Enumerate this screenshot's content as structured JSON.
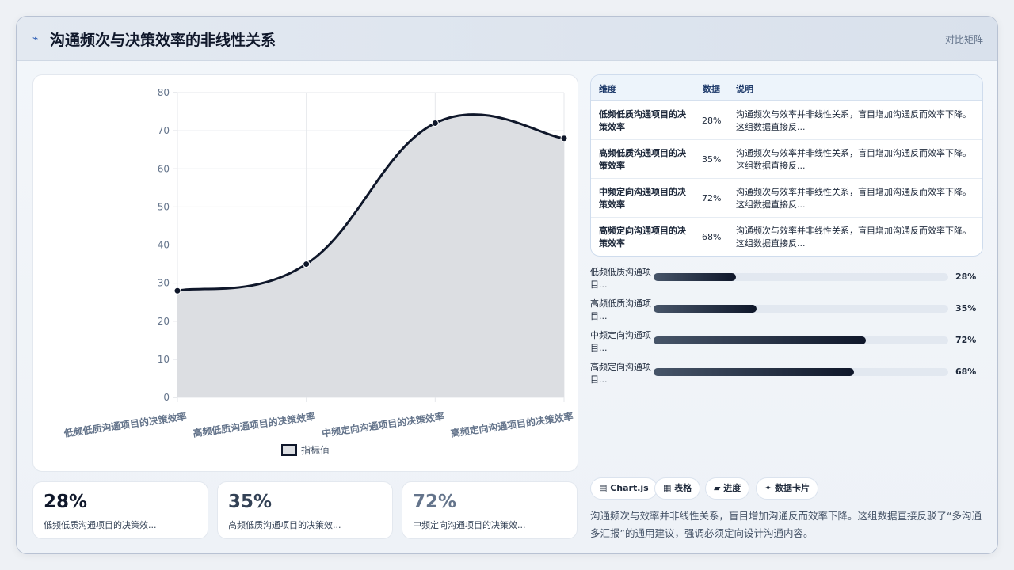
{
  "header": {
    "icon": "flash-icon",
    "title": "沟通频次与决策效率的非线性关系",
    "right_label": "对比矩阵"
  },
  "chart_data": {
    "type": "line",
    "categories": [
      "低频低质沟通项目的决策效率",
      "高频低质沟通项目的决策效率",
      "中频定向沟通项目的决策效率",
      "高频定向沟通项目的决策效率"
    ],
    "series": [
      {
        "name": "指标值",
        "values": [
          28,
          35,
          72,
          68
        ]
      }
    ],
    "ylim": [
      0,
      80
    ],
    "yticks": [
      0,
      10,
      20,
      30,
      40,
      50,
      60,
      70,
      80
    ],
    "legend": "bottom",
    "grid": true,
    "fill": true,
    "colors": {
      "line": "#0f172a",
      "fill": "#dcdee2"
    }
  },
  "stats": [
    {
      "value": "28%",
      "label": "低频低质沟通项目的决策效...",
      "color": "#0f172a"
    },
    {
      "value": "35%",
      "label": "高频低质沟通项目的决策效...",
      "color": "#334155"
    },
    {
      "value": "72%",
      "label": "中频定向沟通项目的决策效...",
      "color": "#64748b"
    }
  ],
  "table": {
    "headers": [
      "维度",
      "数据",
      "说明"
    ],
    "rows": [
      {
        "name": "低频低质沟通项目的决策效率",
        "value": "28%",
        "desc": "沟通频次与效率并非线性关系，盲目增加沟通反而效率下降。这组数据直接反..."
      },
      {
        "name": "高频低质沟通项目的决策效率",
        "value": "35%",
        "desc": "沟通频次与效率并非线性关系，盲目增加沟通反而效率下降。这组数据直接反..."
      },
      {
        "name": "中频定向沟通项目的决策效率",
        "value": "72%",
        "desc": "沟通频次与效率并非线性关系，盲目增加沟通反而效率下降。这组数据直接反..."
      },
      {
        "name": "高频定向沟通项目的决策效率",
        "value": "68%",
        "desc": "沟通频次与效率并非线性关系，盲目增加沟通反而效率下降。这组数据直接反..."
      }
    ]
  },
  "bars": [
    {
      "label": "低频低质沟通项目...",
      "value": 28,
      "pct": "28%"
    },
    {
      "label": "高频低质沟通项目...",
      "value": 35,
      "pct": "35%"
    },
    {
      "label": "中频定向沟通项目...",
      "value": 72,
      "pct": "72%"
    },
    {
      "label": "高频定向沟通项目...",
      "value": 68,
      "pct": "68%"
    }
  ],
  "chips": [
    "▤ Chart.js",
    "▦ 表格",
    "▰ 进度",
    "✦ 数据卡片"
  ],
  "summary": "沟通频次与效率并非线性关系，盲目增加沟通反而效率下降。这组数据直接反驳了“多沟通多汇报”的通用建议，强调必须定向设计沟通内容。"
}
